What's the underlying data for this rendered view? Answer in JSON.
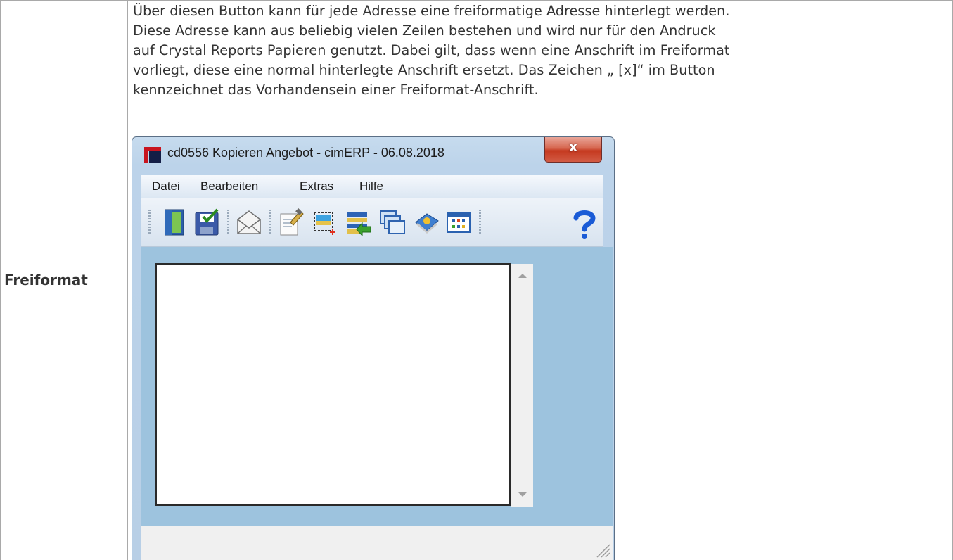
{
  "table": {
    "row_label": "Freiformat",
    "description": "Über diesen Button kann für jede Adresse eine freiformatige Adresse hinterlegt werden.\nDiese Adresse kann aus beliebig vielen Zeilen bestehen und wird nur für den Andruck\nauf Crystal Reports Papieren genutzt. Dabei gilt, dass wenn eine Anschrift im Freiformat\nvorliegt, diese eine normal hinterlegte Anschrift ersetzt. Das Zeichen „ [x]“ im Button\nkennzeichnet das Vorhandensein einer Freiformat-Anschrift."
  },
  "window": {
    "title": "cd0556 Kopieren Angebot - cimERP - 06.08.2018",
    "close_glyph": "x",
    "menu": [
      {
        "prefix": "",
        "accel": "D",
        "rest": "atei"
      },
      {
        "prefix": "",
        "accel": "B",
        "rest": "earbeiten"
      },
      {
        "prefix": "E",
        "accel": "x",
        "rest": "tras"
      },
      {
        "prefix": "",
        "accel": "H",
        "rest": "ilfe"
      }
    ],
    "toolbar_icons": [
      "exit-door-icon",
      "save-icon",
      "mail-envelope-icon",
      "edit-document-icon",
      "select-area-icon",
      "list-transfer-icon",
      "windows-stack-icon",
      "book-icon",
      "calendar-grid-icon",
      "help-question-icon"
    ],
    "textarea_value": "",
    "colors": {
      "client_bg": "#9dc3de",
      "close_red": "#c5391f",
      "help_blue": "#1a5bd6"
    }
  }
}
